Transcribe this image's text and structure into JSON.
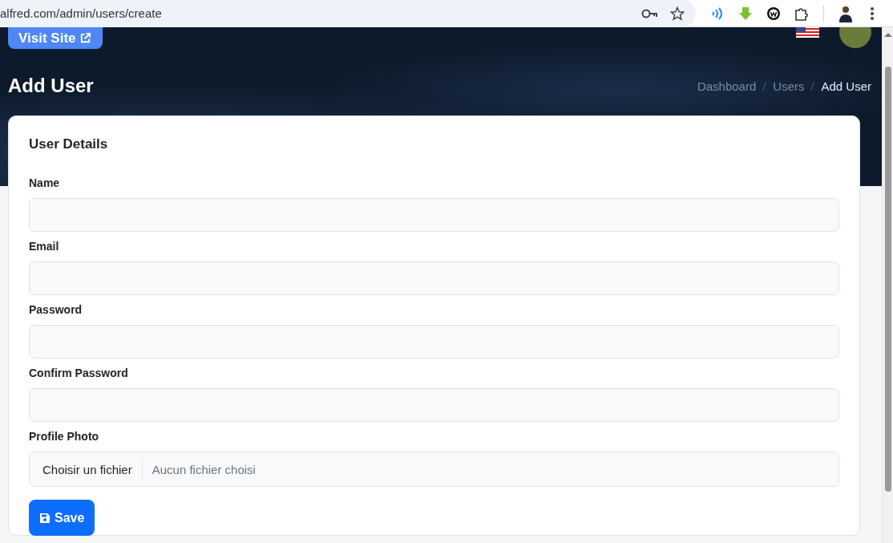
{
  "browser": {
    "url": "alfred.com/admin/users/create"
  },
  "header": {
    "visit_site": "Visit Site",
    "title": "Add User",
    "breadcrumbs": [
      {
        "label": "Dashboard",
        "current": false
      },
      {
        "label": "Users",
        "current": false
      },
      {
        "label": "Add User",
        "current": true
      }
    ]
  },
  "card": {
    "title": "User Details",
    "fields": [
      {
        "kind": "text",
        "label": "Name"
      },
      {
        "kind": "text",
        "label": "Email"
      },
      {
        "kind": "text",
        "label": "Password"
      },
      {
        "kind": "text",
        "label": "Confirm Password"
      },
      {
        "kind": "file",
        "label": "Profile Photo",
        "button": "Choisir un fichier",
        "status": "Aucun fichier choisi"
      }
    ],
    "save": "Save"
  }
}
